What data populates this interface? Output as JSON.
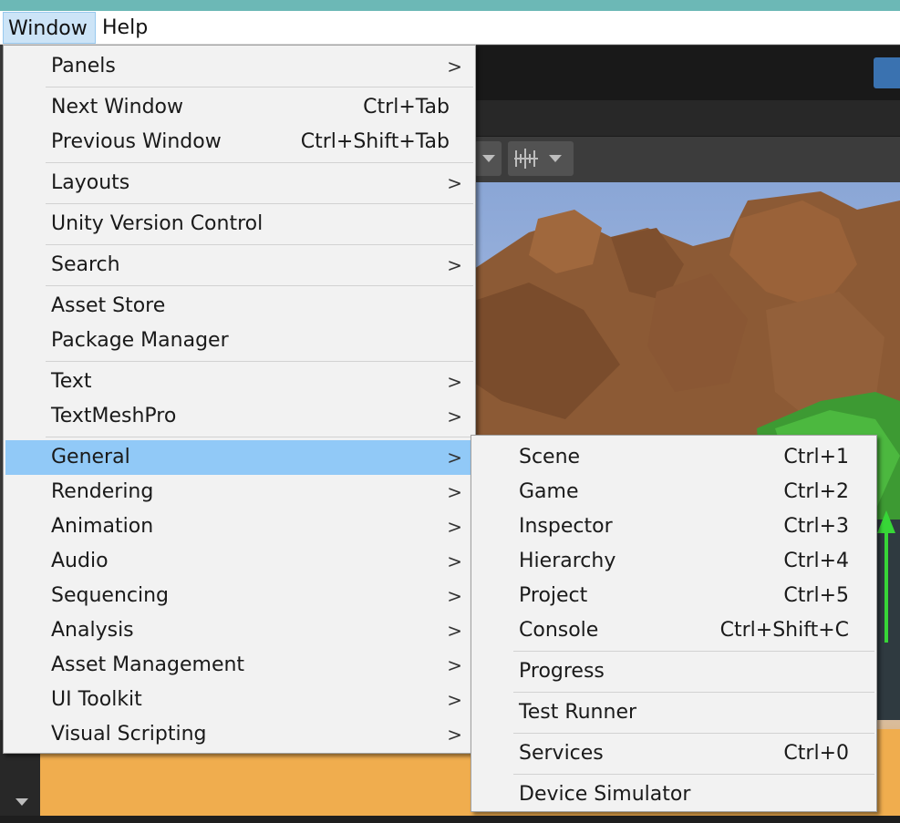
{
  "menubar": {
    "items": [
      {
        "label": "Window",
        "active": true
      },
      {
        "label": "Help",
        "active": false
      }
    ]
  },
  "window_menu": {
    "submenu_glyph": ">",
    "groups": [
      [
        {
          "label": "Panels",
          "submenu": true
        }
      ],
      [
        {
          "label": "Next Window",
          "shortcut": "Ctrl+Tab"
        },
        {
          "label": "Previous Window",
          "shortcut": "Ctrl+Shift+Tab"
        }
      ],
      [
        {
          "label": "Layouts",
          "submenu": true
        }
      ],
      [
        {
          "label": "Unity Version Control"
        }
      ],
      [
        {
          "label": "Search",
          "submenu": true
        }
      ],
      [
        {
          "label": "Asset Store"
        },
        {
          "label": "Package Manager"
        }
      ],
      [
        {
          "label": "Text",
          "submenu": true
        },
        {
          "label": "TextMeshPro",
          "submenu": true
        }
      ],
      [
        {
          "label": "General",
          "submenu": true,
          "highlighted": true
        },
        {
          "label": "Rendering",
          "submenu": true
        },
        {
          "label": "Animation",
          "submenu": true
        },
        {
          "label": "Audio",
          "submenu": true
        },
        {
          "label": "Sequencing",
          "submenu": true
        },
        {
          "label": "Analysis",
          "submenu": true
        },
        {
          "label": "Asset Management",
          "submenu": true
        },
        {
          "label": "UI Toolkit",
          "submenu": true
        },
        {
          "label": "Visual Scripting",
          "submenu": true
        }
      ]
    ]
  },
  "general_submenu": {
    "groups": [
      [
        {
          "label": "Scene",
          "shortcut": "Ctrl+1"
        },
        {
          "label": "Game",
          "shortcut": "Ctrl+2"
        },
        {
          "label": "Inspector",
          "shortcut": "Ctrl+3"
        },
        {
          "label": "Hierarchy",
          "shortcut": "Ctrl+4"
        },
        {
          "label": "Project",
          "shortcut": "Ctrl+5"
        },
        {
          "label": "Console",
          "shortcut": "Ctrl+Shift+C"
        }
      ],
      [
        {
          "label": "Progress"
        }
      ],
      [
        {
          "label": "Test Runner"
        }
      ],
      [
        {
          "label": "Services",
          "shortcut": "Ctrl+0"
        }
      ],
      [
        {
          "label": "Device Simulator"
        }
      ]
    ]
  },
  "colors": {
    "menu_bg": "#f2f2f2",
    "highlight": "#91c9f7",
    "menubar_active": "#cce4f7",
    "title_strip": "#6cb8b6"
  }
}
